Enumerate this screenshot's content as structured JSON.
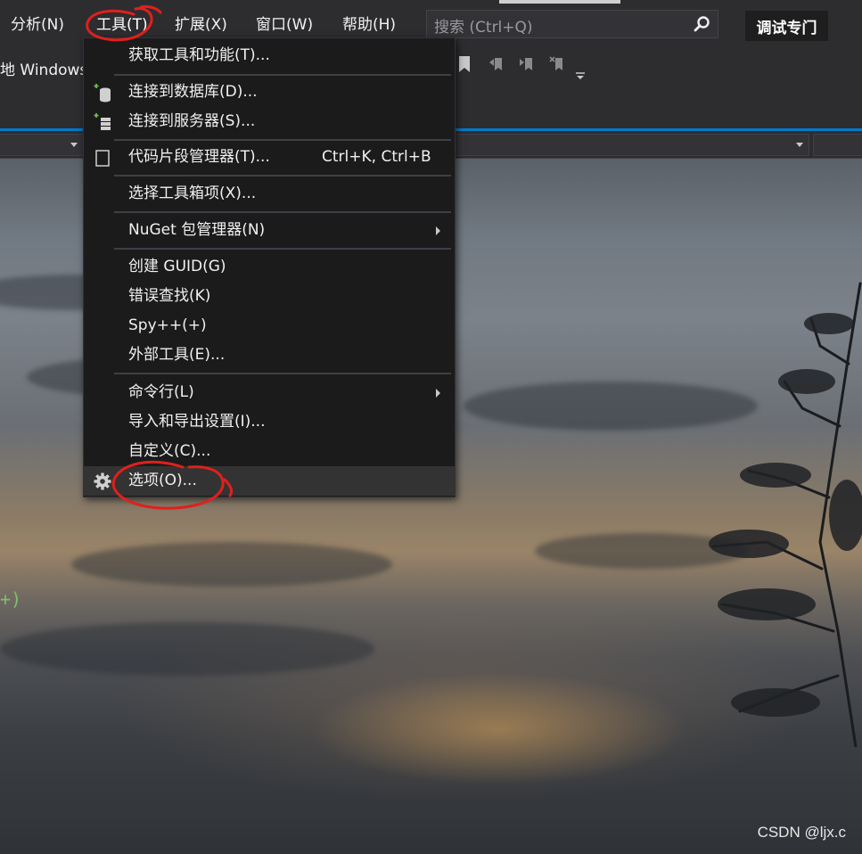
{
  "menubar": {
    "items": [
      {
        "label": "分析(N)"
      },
      {
        "label": "工具(T)"
      },
      {
        "label": "扩展(X)"
      },
      {
        "label": "窗口(W)"
      },
      {
        "label": "帮助(H)"
      }
    ],
    "search_placeholder": "搜索 (Ctrl+Q)",
    "debug_button": "调试专门"
  },
  "toolbar": {
    "target_text": "地 Windows"
  },
  "tools_menu": {
    "items": [
      {
        "label": "获取工具和功能(T)...",
        "icon": "none"
      },
      {
        "label": "连接到数据库(D)...",
        "icon": "database-add-icon"
      },
      {
        "label": "连接到服务器(S)...",
        "icon": "server-add-icon"
      },
      {
        "label": "代码片段管理器(T)...",
        "icon": "snippet-icon",
        "shortcut": "Ctrl+K, Ctrl+B"
      },
      {
        "label": "选择工具箱项(X)...",
        "icon": "none"
      },
      {
        "label": "NuGet 包管理器(N)",
        "icon": "none",
        "submenu": true
      },
      {
        "label": "创建 GUID(G)",
        "icon": "none"
      },
      {
        "label": "错误查找(K)",
        "icon": "none"
      },
      {
        "label": "Spy++(+)",
        "icon": "none"
      },
      {
        "label": "外部工具(E)...",
        "icon": "none"
      },
      {
        "label": "命令行(L)",
        "icon": "none",
        "submenu": true
      },
      {
        "label": "导入和导出设置(I)...",
        "icon": "none"
      },
      {
        "label": "自定义(C)...",
        "icon": "none"
      },
      {
        "label": "选项(O)...",
        "icon": "gear-icon",
        "highlighted": true
      }
    ]
  },
  "editor": {
    "stray_code": "+)"
  },
  "watermark": "CSDN @ljx.c",
  "colors": {
    "menu_bg": "#1b1b1c",
    "chrome_bg": "#2d2d30",
    "accent": "#007acc",
    "annotation": "#e0201c"
  }
}
